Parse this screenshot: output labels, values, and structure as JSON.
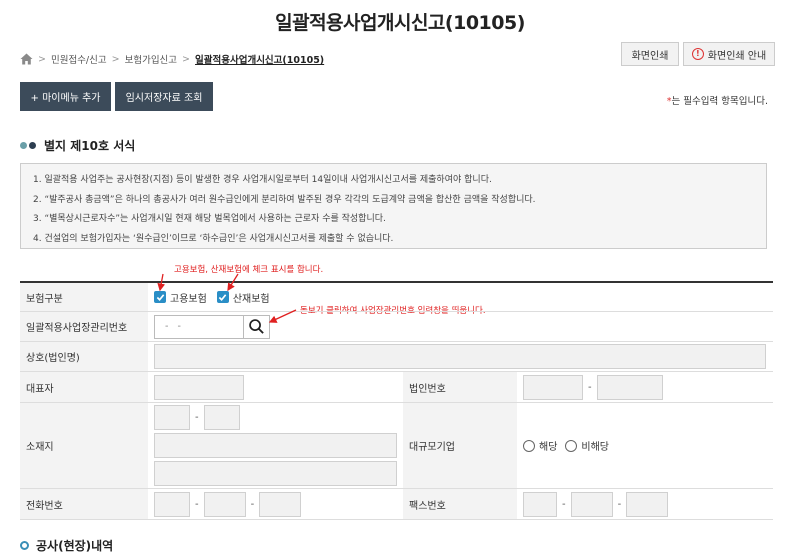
{
  "page": {
    "title": "일괄적용사업개시신고(10105)"
  },
  "breadcrumb": {
    "items": [
      "민원접수/신고",
      "보험가입신고",
      "일괄적용사업개시신고(10105)"
    ]
  },
  "header": {
    "print_label": "화면인쇄",
    "print_guide_label": "화면인쇄 안내"
  },
  "toolbar": {
    "add_menu_label": "+ 마이메뉴 추가",
    "temp_save_label": "임시저장자료 조회",
    "required_note": "는 필수입력 항목입니다.",
    "required_star": "*"
  },
  "section": {
    "title": "별지 제10호 서식"
  },
  "notice": {
    "lines": [
      "1. 일괄적용 사업주는 공사현장(지점) 등이 발생한 경우 사업개시일로부터 14일이내 사업개시신고서를 제출하여야 합니다.",
      "2. “발주공사 총금액”은 하나의 총공사가 여러 원수급인에게 분리하여 발주된 경우 각각의 도급계약 금액을 합산한 금액을 작성합니다.",
      "3. “별목상시근로자수”는 사업개시일 현재 해당 벌목업에서 사용하는 근로자 수를 작성합니다.",
      "4. 건설업의 보험가입자는 ‘원수급인’이므로 ‘하수급인’은 사업개시신고서를 제출할 수 없습니다."
    ]
  },
  "annotations": {
    "insurance_note": "고용보험, 산재보험에 체크 표시를 합니다.",
    "search_note": "돋보기 클릭하여 사업장관리번호 입력창을 띄웁니다."
  },
  "form": {
    "insurance_type_label": "보험구분",
    "employment_insurance": "고용보험",
    "accident_insurance": "산재보험",
    "mgmt_no_label": "일괄적용사업장관리번호",
    "mgmt_no_placeholder": "- -",
    "company_name_label": "상호(법인명)",
    "representative_label": "대표자",
    "corp_no_label": "법인번호",
    "address_label": "소재지",
    "large_company_label": "대규모기업",
    "yes_label": "해당",
    "no_label": "비해당",
    "phone_label": "전화번호",
    "fax_label": "팩스번호",
    "dash": "-"
  },
  "section2": {
    "title": "공사(현장)내역"
  },
  "colors": {
    "accent": "#2a8ec6",
    "dark_button": "#3c4b5a",
    "annotation": "#e02020"
  }
}
